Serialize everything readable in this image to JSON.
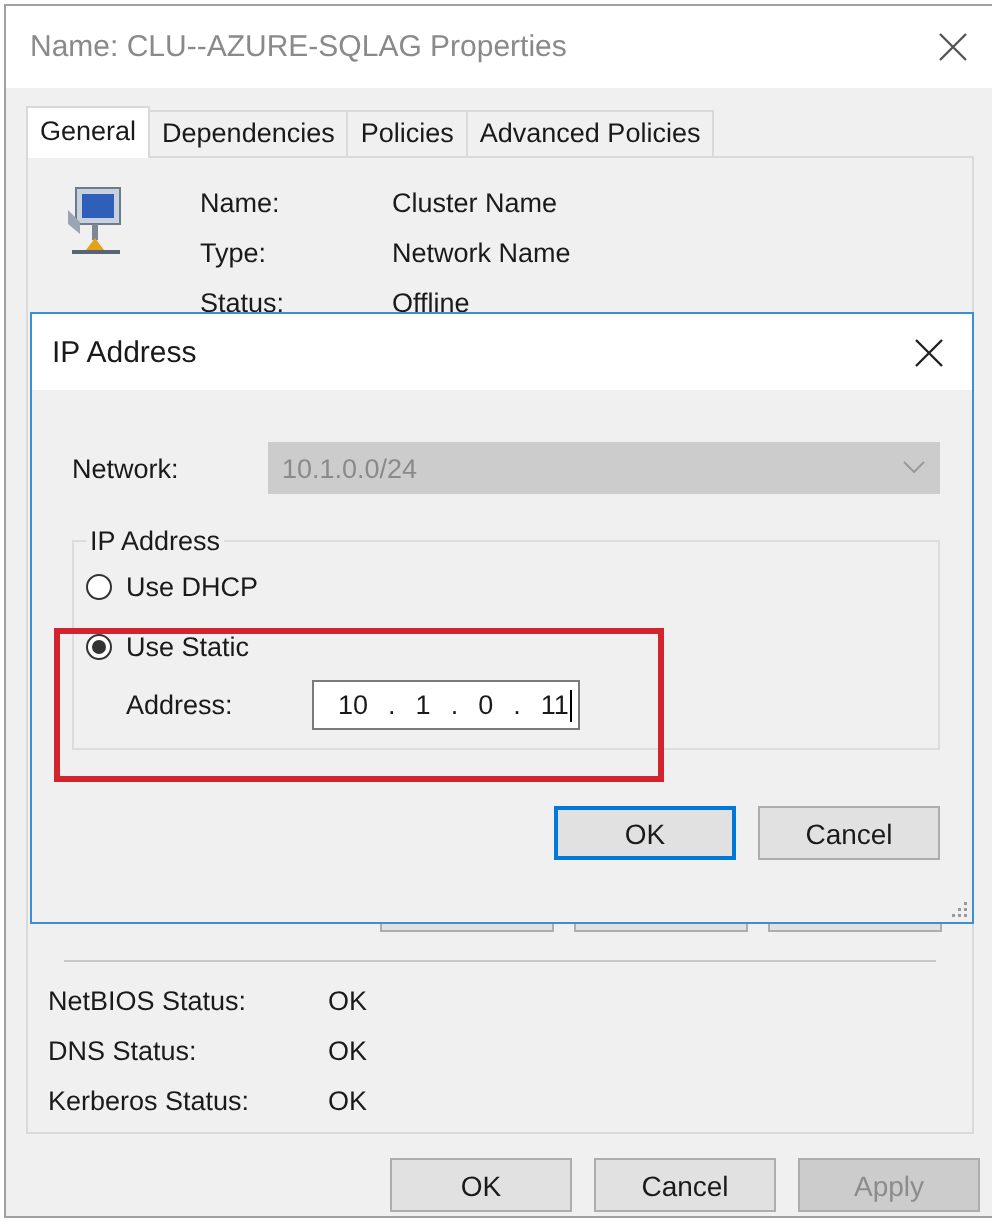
{
  "window": {
    "title": "Name: CLU--AZURE-SQLAG Properties"
  },
  "tabs": [
    {
      "label": "General",
      "selected": true
    },
    {
      "label": "Dependencies",
      "selected": false
    },
    {
      "label": "Policies",
      "selected": false
    },
    {
      "label": "Advanced Policies",
      "selected": false
    }
  ],
  "resource": [
    {
      "label": "Name:",
      "value": "Cluster Name"
    },
    {
      "label": "Type:",
      "value": "Network Name"
    },
    {
      "label": "Status:",
      "value": "Offline"
    }
  ],
  "statuses": [
    {
      "label": "NetBIOS Status:",
      "value": "OK"
    },
    {
      "label": "DNS Status:",
      "value": "OK"
    },
    {
      "label": "Kerberos Status:",
      "value": "OK"
    }
  ],
  "buttons": [
    {
      "label": "OK",
      "disabled": false
    },
    {
      "label": "Cancel",
      "disabled": false
    },
    {
      "label": "Apply",
      "disabled": true
    }
  ],
  "dialog": {
    "title": "IP Address",
    "network": {
      "label": "Network:",
      "value": "10.1.0.0/24",
      "disabled": true
    },
    "group": {
      "title": "IP Address",
      "options": [
        {
          "label": "Use DHCP",
          "selected": false
        },
        {
          "label": "Use Static",
          "selected": true
        }
      ],
      "address": {
        "label": "Address:",
        "octets": [
          "10",
          "1",
          "0",
          "11"
        ],
        "separator": "."
      }
    },
    "buttons": [
      {
        "label": "OK",
        "focused": true
      },
      {
        "label": "Cancel",
        "focused": false
      }
    ]
  }
}
